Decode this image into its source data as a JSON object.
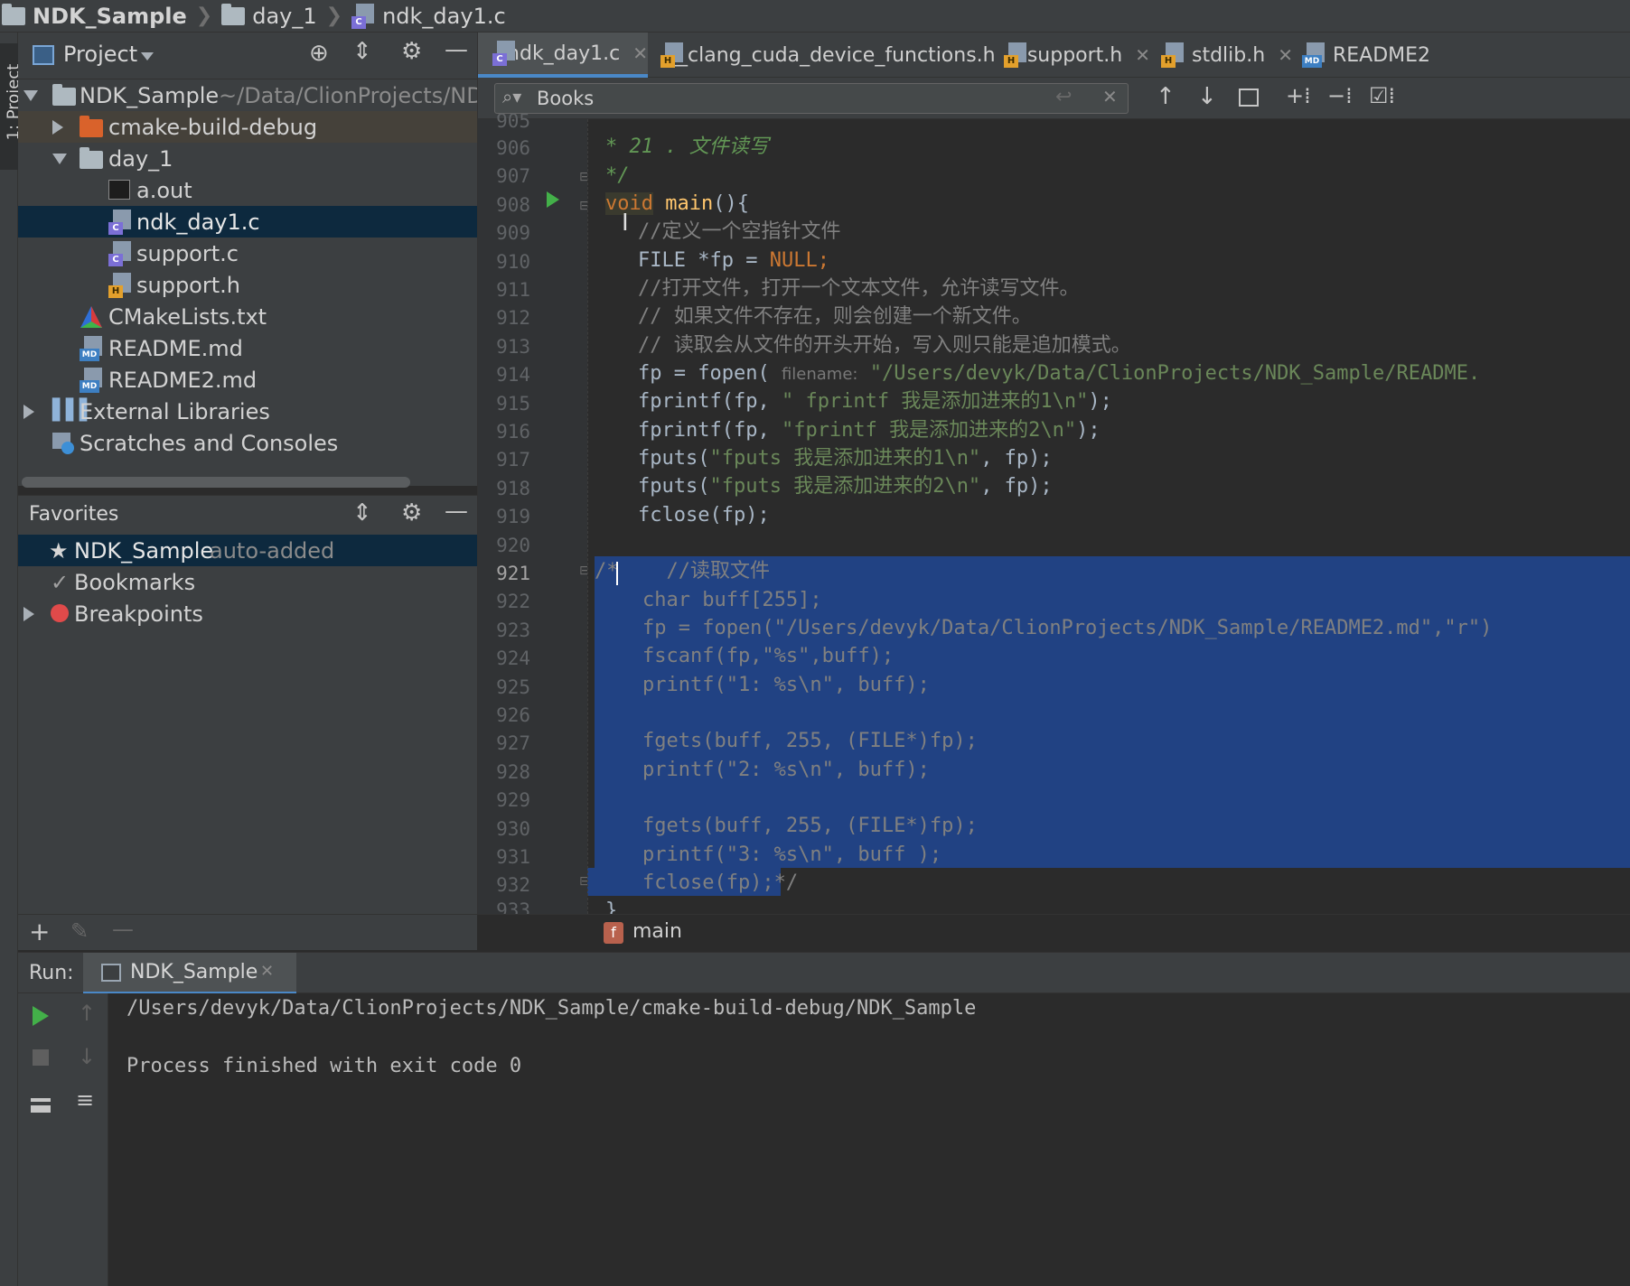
{
  "breadcrumb": {
    "project": "NDK_Sample",
    "folder": "day_1",
    "file": "ndk_day1.c"
  },
  "left_strip": {
    "label": "1: Project"
  },
  "project_panel": {
    "title": "Project",
    "tree": [
      {
        "label": "NDK_Sample",
        "hint": "~/Data/ClionProjects/NDK_"
      },
      {
        "label": "cmake-build-debug"
      },
      {
        "label": "day_1"
      },
      {
        "label": "a.out"
      },
      {
        "label": "ndk_day1.c"
      },
      {
        "label": "support.c"
      },
      {
        "label": "support.h"
      },
      {
        "label": "CMakeLists.txt"
      },
      {
        "label": "README.md"
      },
      {
        "label": "README2.md"
      },
      {
        "label": "External Libraries"
      },
      {
        "label": "Scratches and Consoles"
      }
    ]
  },
  "favorites": {
    "title": "Favorites",
    "items": [
      {
        "label": "NDK_Sample",
        "hint": "auto-added"
      },
      {
        "label": "Bookmarks"
      },
      {
        "label": "Breakpoints"
      }
    ]
  },
  "tabs": [
    {
      "label": "ndk_day1.c",
      "badge": "C"
    },
    {
      "label": "__clang_cuda_device_functions.h",
      "badge": "H"
    },
    {
      "label": "support.h",
      "badge": "H"
    },
    {
      "label": "stdlib.h",
      "badge": "H"
    },
    {
      "label": "README2",
      "badge": "MD"
    }
  ],
  "search": {
    "value": "Books"
  },
  "editor": {
    "line_numbers": [
      "906",
      "907",
      "908",
      "909",
      "910",
      "911",
      "912",
      "913",
      "914",
      "915",
      "916",
      "917",
      "918",
      "919",
      "920",
      "921",
      "922",
      "923",
      "924",
      "925",
      "926",
      "927",
      "928",
      "929",
      "930",
      "931",
      "932"
    ],
    "partial_top": "905",
    "partial_bottom": "933",
    "lines": {
      "l906": "* 21 . 文件读写",
      "l907": "*/",
      "l908_kw": "void",
      "l908_fn": "main",
      "l908_rest": "(){",
      "l909": "//定义一个空指针文件",
      "l910_a": "FILE *fp = ",
      "l910_null": "NULL",
      "l910_semi": ";",
      "l911": "//打开文件，打开一个文本文件，允许读写文件。",
      "l912": "// 如果文件不存在，则会创建一个新文件。",
      "l913": "// 读取会从文件的开头开始，写入则只能是追加模式。",
      "l914_a": "fp = fopen( ",
      "l914_hint": "filename:",
      "l914_str": " \"/Users/devyk/Data/ClionProjects/NDK_Sample/README.",
      "l915_a": "fprintf(fp, ",
      "l915_str": "\" fprintf 我是添加进来的1\\n\"",
      "l915_b": ");",
      "l916_a": "fprintf(fp, ",
      "l916_str": "\"fprintf 我是添加进来的2\\n\"",
      "l916_b": ");",
      "l917_a": "fputs(",
      "l917_str": "\"fputs 我是添加进来的1\\n\"",
      "l917_b": ", fp);",
      "l918_a": "fputs(",
      "l918_str": "\"fputs 我是添加进来的2\\n\"",
      "l918_b": ", fp);",
      "l919": "fclose(fp);",
      "l921": "/*    //读取文件",
      "l922": "    char buff[255];",
      "l923": "    fp = fopen(\"/Users/devyk/Data/ClionProjects/NDK_Sample/README2.md\",\"r\")",
      "l924": "    fscanf(fp,\"%s\",buff);",
      "l925": "    printf(\"1: %s\\n\", buff);",
      "l927": "    fgets(buff, 255, (FILE*)fp);",
      "l928": "    printf(\"2: %s\\n\", buff);",
      "l930": "    fgets(buff, 255, (FILE*)fp);",
      "l931": "    printf(\"3: %s\\n\", buff );",
      "l932": "    fclose(fp);*/",
      "l933": "}"
    }
  },
  "structure": {
    "badge": "f",
    "label": "main"
  },
  "run": {
    "label": "Run:",
    "tab": "NDK_Sample",
    "output_path": "/Users/devyk/Data/ClionProjects/NDK_Sample/cmake-build-debug/NDK_Sample",
    "output_status": "Process finished with exit code 0"
  },
  "colors": {
    "selection": "#214283",
    "keyword": "#cc7832",
    "function": "#ffc66d",
    "string": "#6a8759",
    "accent": "#4a88c7"
  }
}
